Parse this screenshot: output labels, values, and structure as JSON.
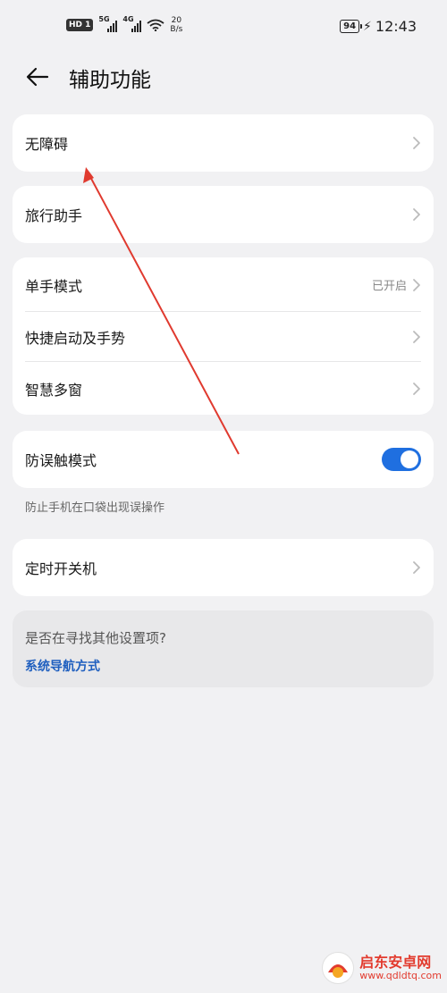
{
  "status_bar": {
    "hd": "HD",
    "sim_num": "1",
    "net1": "5G",
    "net2": "4G",
    "speed_value": "20",
    "speed_unit": "B/s",
    "battery": "94",
    "time": "12:43"
  },
  "header": {
    "title": "辅助功能"
  },
  "groups": {
    "accessibility": {
      "label": "无障碍"
    },
    "travel": {
      "label": "旅行助手"
    },
    "one_hand": {
      "label": "单手模式",
      "value": "已开启"
    },
    "shortcuts": {
      "label": "快捷启动及手势"
    },
    "multi_window": {
      "label": "智慧多窗"
    },
    "pocket_mode": {
      "label": "防误触模式",
      "enabled": true
    },
    "pocket_caption": "防止手机在口袋出现误操作",
    "scheduled_power": {
      "label": "定时开关机"
    }
  },
  "suggestion": {
    "question": "是否在寻找其他设置项?",
    "link": "系统导航方式"
  },
  "watermark": {
    "name": "启东安卓网",
    "url": "www.qdldtq.com"
  },
  "colors": {
    "toggle_on": "#1f6fe0",
    "link": "#1f5fbf",
    "annotation_arrow": "#e03a2f"
  }
}
